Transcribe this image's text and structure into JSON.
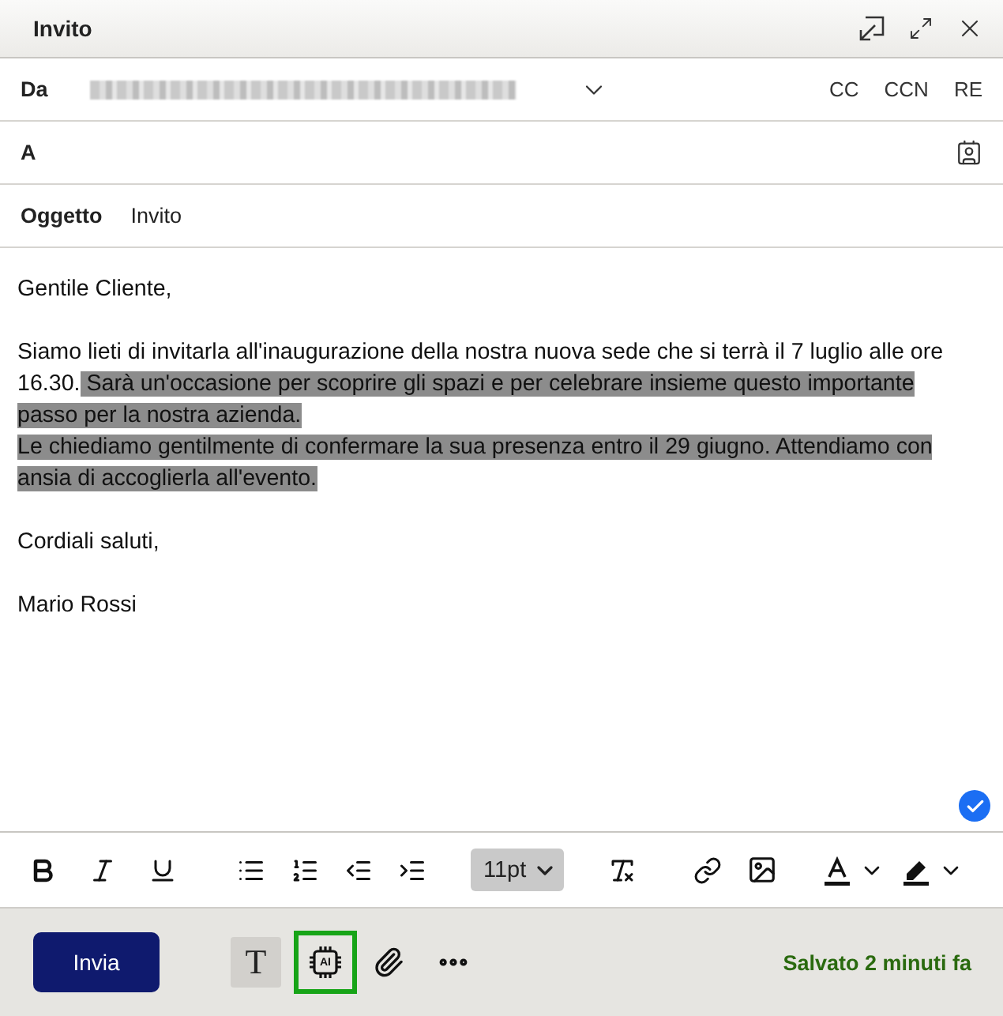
{
  "window": {
    "title": "Invito"
  },
  "from": {
    "label": "Da",
    "redacted": true
  },
  "header_links": [
    "CC",
    "CCN",
    "RE"
  ],
  "to": {
    "label": "A"
  },
  "subject": {
    "label": "Oggetto",
    "value": "Invito"
  },
  "body": {
    "paragraphs": [
      {
        "lines": [
          {
            "segments": [
              {
                "text": "Gentile Cliente,",
                "selected": false
              }
            ]
          }
        ]
      },
      {
        "lines": [
          {
            "segments": [
              {
                "text": "Siamo lieti di invitarla all'inaugurazione della nostra nuova sede che si terrà il 7 luglio alle ore 16.30.",
                "selected": false
              },
              {
                "text": " Sarà un'occasione per scoprire gli spazi e per celebrare insieme questo importante passo per la nostra azienda.",
                "selected": true
              }
            ]
          },
          {
            "segments": [
              {
                "text": "Le chiediamo gentilmente di confermare la sua presenza entro il 29 giugno. Attendiamo con ansia di accoglierla all'evento.",
                "selected": true
              }
            ]
          }
        ]
      },
      {
        "lines": [
          {
            "segments": [
              {
                "text": "Cordiali saluti,",
                "selected": false
              }
            ]
          }
        ]
      },
      {
        "lines": [
          {
            "segments": [
              {
                "text": "Mario Rossi",
                "selected": false
              }
            ]
          }
        ]
      }
    ],
    "check_badge": true
  },
  "toolbar": {
    "font_size": "11pt"
  },
  "footer": {
    "send": "Invia",
    "format_glyph": "T",
    "format_selected": true,
    "ai_label": "AI",
    "ai_selected": true,
    "status": "Salvato 2 minuti fa"
  }
}
